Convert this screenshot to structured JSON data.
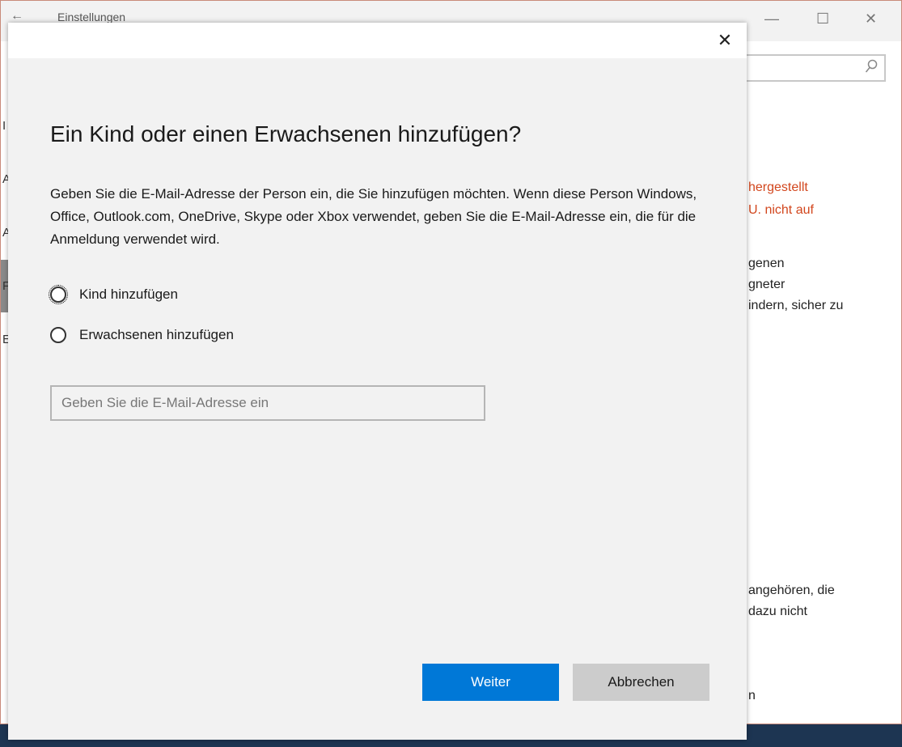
{
  "background_window": {
    "title": "Einstellungen",
    "back_glyph": "←",
    "minimize_glyph": "—",
    "maximize_glyph": "☐",
    "close_glyph": "✕",
    "search_icon": "search-icon",
    "left_letters": [
      "I",
      "A",
      "A",
      "F",
      "E"
    ],
    "content_lines": [
      {
        "text": "hergestellt",
        "warn": true
      },
      {
        "text": "U. nicht auf",
        "warn": true
      },
      {
        "text": "genen",
        "warn": false
      },
      {
        "text": "gneter",
        "warn": false
      },
      {
        "text": "indern, sicher zu",
        "warn": false
      },
      {
        "text": "angehören, die",
        "warn": false
      },
      {
        "text": "dazu nicht",
        "warn": false
      },
      {
        "text": "n",
        "warn": false
      }
    ],
    "warn_color": "#d2461d"
  },
  "dialog": {
    "close_glyph": "✕",
    "heading": "Ein Kind oder einen Erwachsenen hinzufügen?",
    "description": "Geben Sie die E-Mail-Adresse der Person ein, die Sie hinzufügen möchten. Wenn diese Person Windows, Office, Outlook.com, OneDrive, Skype oder Xbox verwendet, geben Sie die E-Mail-Adresse ein, die für die Anmeldung verwendet wird.",
    "options": [
      {
        "label": "Kind hinzufügen",
        "selected": false,
        "focused": true
      },
      {
        "label": "Erwachsenen hinzufügen",
        "selected": false,
        "focused": false
      }
    ],
    "email": {
      "value": "",
      "placeholder": "Geben Sie die E-Mail-Adresse ein"
    },
    "primary_button": "Weiter",
    "secondary_button": "Abbrechen",
    "accent_color": "#0078d7"
  }
}
